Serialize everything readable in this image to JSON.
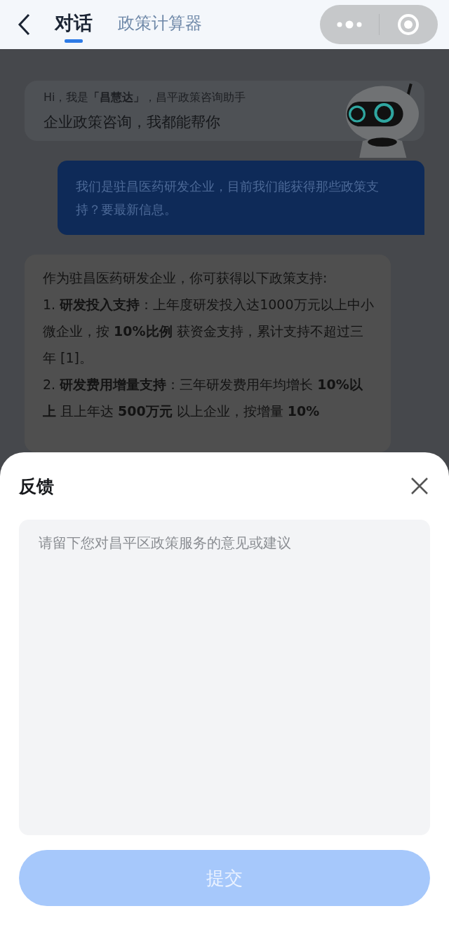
{
  "header": {
    "tabs": [
      {
        "label": "对话",
        "selected": true
      },
      {
        "label": "政策计算器",
        "selected": false
      }
    ]
  },
  "chat": {
    "greeting": {
      "line_1": "Hi，我是**「昌慧达」**，昌平政策咨询助手",
      "line_2": "企业政策咨询，我都能帮你"
    },
    "messages": [
      {
        "kind": "user",
        "paragraphs": [
          "我们是驻昌医药研发企业，目前我们能获得那些政策支持？要最新信息。"
        ]
      },
      {
        "kind": "bot",
        "paragraphs": [
          "作为驻昌医药研发企业，你可获得以下政策支持:",
          "1. **研发投入支持**：上年度研发投入达1000万元以上中小微企业，按 **10%比例** 获资金支持，累计支持不超过三年 [1]。",
          "2. **研发费用增量支持**：三年研发费用年均增长 **10%以上** 且上年达 **500万元** 以上企业，按增量 **10%**"
        ]
      }
    ]
  },
  "feedback_sheet": {
    "title": "反馈",
    "field": {
      "placeholder": "请留下您对昌平区政策服务的意见或建议"
    },
    "submit": {
      "label": "提交",
      "disabled": true
    }
  }
}
